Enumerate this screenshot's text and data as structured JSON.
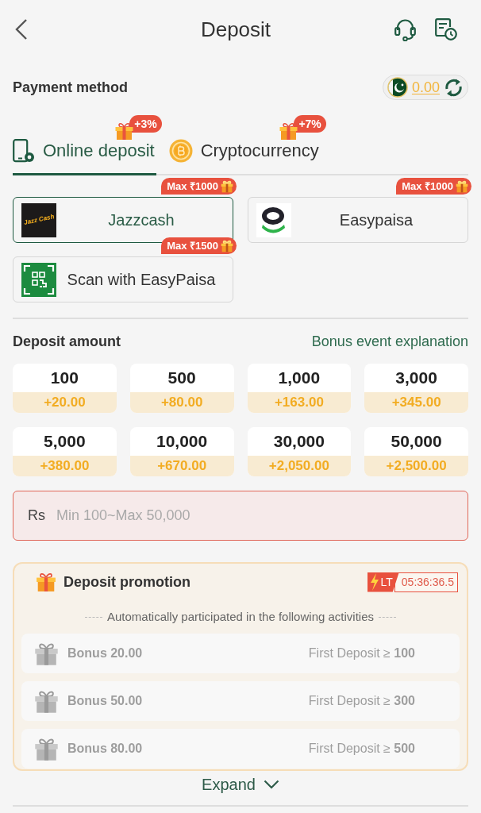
{
  "header": {
    "title": "Deposit"
  },
  "payment": {
    "label": "Payment method",
    "balance": "0.00"
  },
  "tabs": [
    {
      "label": "Online deposit",
      "kind": "phone",
      "badge": "+3%",
      "selected": true
    },
    {
      "label": "Cryptocurrency",
      "kind": "crypto",
      "badge": "+7%",
      "selected": false
    }
  ],
  "methods": [
    {
      "name": "Jazzcash",
      "kind": "jazzcash",
      "logo_text": "Jazz Cash",
      "badge": "Max ₹1000",
      "selected": true
    },
    {
      "name": "Easypaisa",
      "kind": "easypaisa",
      "badge": "Max ₹1000",
      "selected": false
    },
    {
      "name": "Scan with EasyPaisa",
      "kind": "qr",
      "badge": "Max ₹1500",
      "selected": false
    }
  ],
  "amount": {
    "label": "Deposit amount",
    "link": "Bonus event explanation",
    "options": [
      {
        "amount": "100",
        "bonus": "+20.00",
        "selected": false
      },
      {
        "amount": "500",
        "bonus": "+80.00",
        "selected": false
      },
      {
        "amount": "1,000",
        "bonus": "+163.00",
        "selected": false
      },
      {
        "amount": "3,000",
        "bonus": "+345.00",
        "selected": false
      },
      {
        "amount": "5,000",
        "bonus": "+380.00",
        "selected": false
      },
      {
        "amount": "10,000",
        "bonus": "+670.00",
        "selected": false
      },
      {
        "amount": "30,000",
        "bonus": "+2,050.00",
        "selected": false
      },
      {
        "amount": "50,000",
        "bonus": "+2,500.00",
        "selected": false
      }
    ],
    "input": {
      "prefix": "Rs",
      "placeholder": "Min 100~Max 50,000"
    }
  },
  "promotion": {
    "title": "Deposit promotion",
    "timer_tag": "LT",
    "timer": "05:36:36.5",
    "subtitle": "Automatically participated in the following activities",
    "rows": [
      {
        "bonus": "Bonus 20.00",
        "condition": "First Deposit ≥ **100**",
        "disabled": true
      },
      {
        "bonus": "Bonus 50.00",
        "condition": "First Deposit ≥ **300**",
        "disabled": true
      },
      {
        "bonus": "Bonus 80.00",
        "condition": "First Deposit ≥ **500**",
        "disabled": true
      }
    ],
    "expand": "Expand"
  }
}
